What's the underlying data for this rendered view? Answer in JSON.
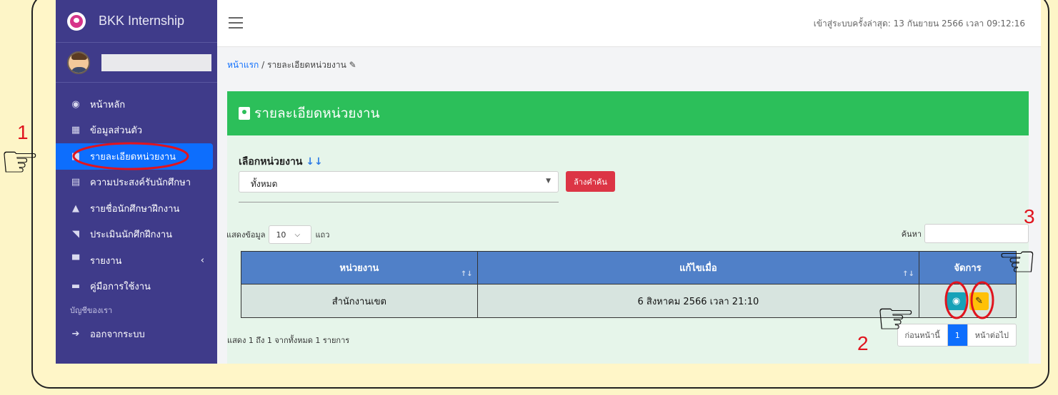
{
  "brand": {
    "name": "BKK Internship"
  },
  "sidebar": {
    "items": [
      {
        "label": "หน้าหลัก",
        "icon": "dashboard-icon"
      },
      {
        "label": "ข้อมูลส่วนตัว",
        "icon": "calendar-icon"
      },
      {
        "label": "รายละเอียดหน่วยงาน",
        "icon": "briefcase-icon",
        "active": true
      },
      {
        "label": "ความประสงค์รับนักศึกษา",
        "icon": "id-card-icon"
      },
      {
        "label": "รายชื่อนักศึกษาฝึกงาน",
        "icon": "user-tie-icon"
      },
      {
        "label": "ประเมินนักศึกฝึกงาน",
        "icon": "rss-icon"
      },
      {
        "label": "รายงาน",
        "icon": "archive-icon",
        "has_submenu": true
      },
      {
        "label": "คู่มือการใช้งาน",
        "icon": "book-icon"
      }
    ],
    "section_header": "บัญชีของเรา",
    "logout": {
      "label": "ออกจากระบบ",
      "icon": "sign-out-icon"
    }
  },
  "topbar": {
    "last_login": "เข้าสู่ระบบครั้งล่าสุด: 13 กันยายน 2566 เวลา 09:12:16"
  },
  "breadcrumb": {
    "home": "หน้าแรก",
    "separator": "/",
    "current": "รายละเอียดหน่วยงาน"
  },
  "card": {
    "title": "รายละเอียดหน่วยงาน",
    "select_label": "เลือกหน่วยงาน",
    "select_value": "ทั้งหมด",
    "clear_button": "ล้างคำค้น",
    "length_prefix": "แสดงข้อมูล",
    "length_value": "10",
    "length_suffix": "แถว",
    "search_label": "ค้นหา",
    "columns": [
      "หน่วยงาน",
      "แก้ไขเมื่อ",
      "จัดการ"
    ],
    "rows": [
      {
        "unit": "สำนักงานเขต",
        "modified": "6 สิงหาคม 2566 เวลา 21:10"
      }
    ],
    "info": "แสดง 1 ถึง 1 จากทั้งหมด 1 รายการ",
    "pagination": {
      "prev": "ก่อนหน้านี้",
      "current": "1",
      "next": "หน้าต่อไป"
    }
  },
  "annotations": [
    "1",
    "2",
    "3"
  ],
  "colors": {
    "sidebar": "#3f3b8a",
    "active": "#0d6efd",
    "header": "#2cbf5a",
    "table_head": "#5080c8",
    "annotation": "#e0141e"
  }
}
